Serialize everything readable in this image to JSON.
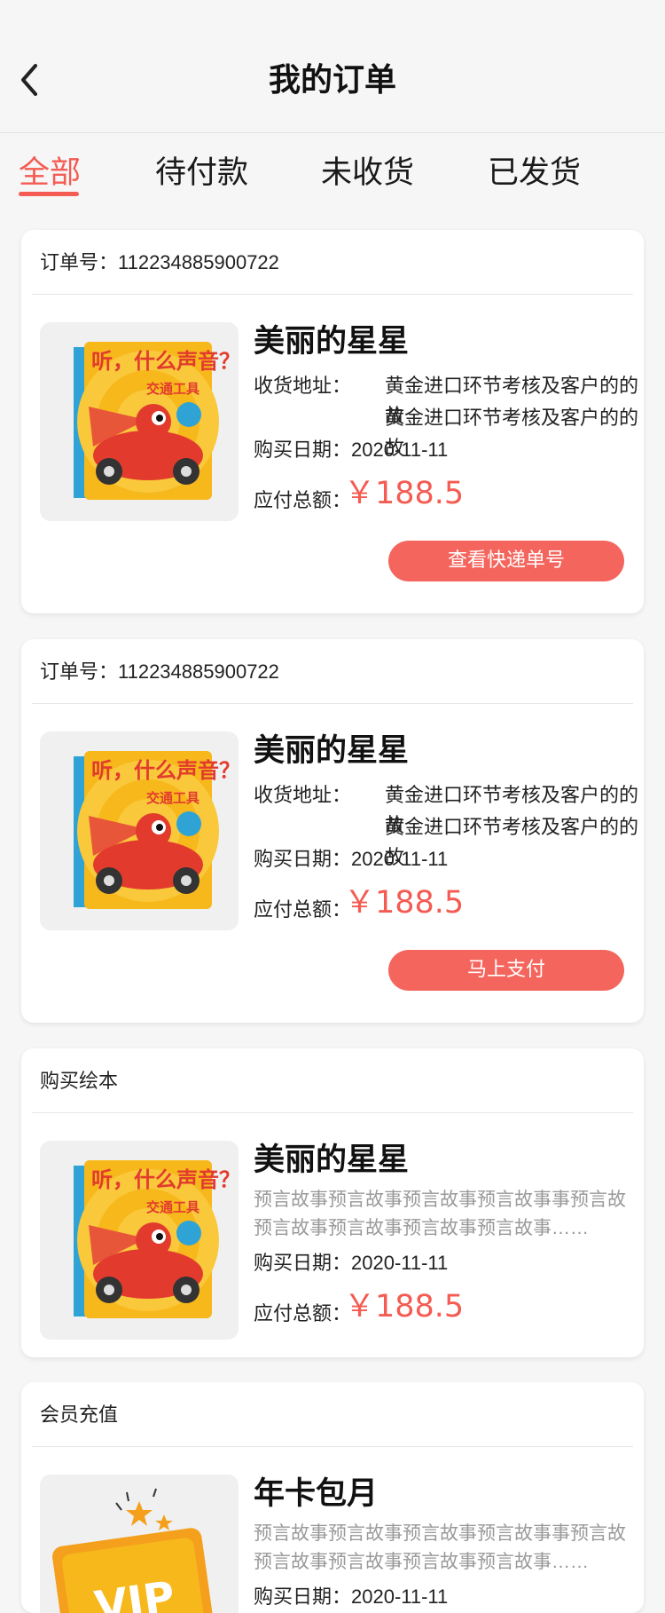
{
  "header": {
    "title": "我的订单"
  },
  "tabs": [
    {
      "label": "全部"
    },
    {
      "label": "待付款"
    },
    {
      "label": "未收货"
    },
    {
      "label": "已发货"
    }
  ],
  "orders": [
    {
      "head": "订单号：112234885900722",
      "name": "美丽的星星",
      "address_label": "收货地址：",
      "address_line1": "黄金进口环节考核及客户的的故",
      "address_line2": "黄金进口环节考核及客户的的故",
      "date": "购买日期：2020-11-11",
      "total_label": "应付总额：",
      "price": "￥188.5",
      "button": "查看快递单号"
    },
    {
      "head": "订单号：112234885900722",
      "name": "美丽的星星",
      "address_label": "收货地址：",
      "address_line1": "黄金进口环节考核及客户的的故",
      "address_line2": "黄金进口环节考核及客户的的故",
      "date": "购买日期：2020-11-11",
      "total_label": "应付总额：",
      "price": "￥188.5",
      "button": "马上支付"
    },
    {
      "head": "购买绘本",
      "name": "美丽的星星",
      "desc_line1": "预言故事预言故事预言故事预言故事事预言故",
      "desc_line2": "预言故事预言故事预言故事预言故事……",
      "date": "购买日期：2020-11-11",
      "total_label": "应付总额：",
      "price": "￥188.5"
    },
    {
      "head": "会员充值",
      "name": "年卡包月",
      "desc_line1": "预言故事预言故事预言故事预言故事事预言故",
      "desc_line2": "预言故事预言故事预言故事预言故事……",
      "date": "购买日期：2020-11-11"
    }
  ],
  "book_cover": {
    "title_text": "听，什么声音？",
    "subtitle_text": "交通工具",
    "spine_text": "交通工具"
  },
  "vip_badge": {
    "text": "VIP"
  },
  "colors": {
    "accent": "#f45b52",
    "button": "#f4655d",
    "muted_text": "#999999"
  },
  "icons": {
    "back": "chevron-left-icon"
  }
}
